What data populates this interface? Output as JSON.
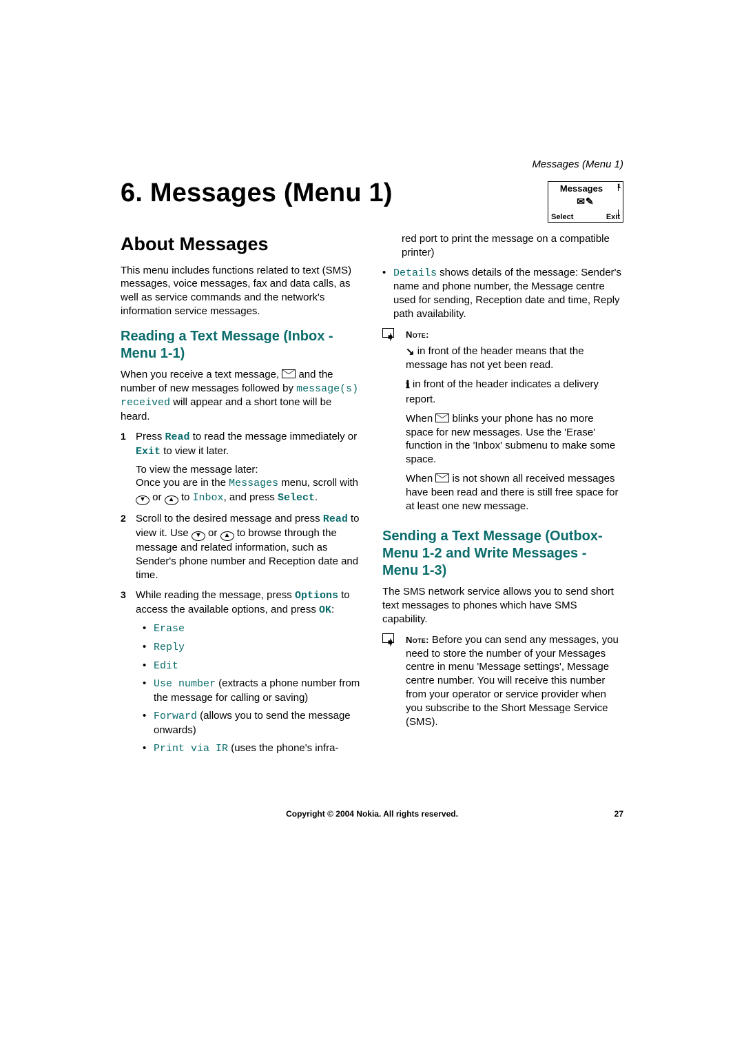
{
  "runningHeader": "Messages (Menu 1)",
  "chapterTitle": "6. Messages (Menu 1)",
  "phoneScreen": {
    "title": "Messages",
    "menuNumber": "1",
    "softLeft": "Select",
    "softRight": "Exit"
  },
  "about": {
    "heading": "About Messages",
    "intro": "This menu includes functions related to text (SMS) messages, voice messages, fax and data calls, as well as service commands and the network's information service messages."
  },
  "reading": {
    "heading": "Reading a Text Message (Inbox - Menu 1-1)",
    "intro_before": "When you receive a text message, ",
    "intro_after_env": " and the number of new messages followed by ",
    "mono_msg": "message(s) received",
    "intro_tail": " will appear and a short tone will be heard.",
    "step1_a": "Press ",
    "step1_read": "Read",
    "step1_b": " to read the message immediately or ",
    "step1_exit": "Exit",
    "step1_c": " to view it later.",
    "step1_p2a": "To view the message later:",
    "step1_p2b_a": "Once you are in the ",
    "step1_p2b_m": "Messages",
    "step1_p2b_b": " menu, scroll with ",
    "step1_p2b_or": " or ",
    "step1_p2b_to": " to ",
    "step1_p2b_inbox": "Inbox",
    "step1_p2b_c": ", and press ",
    "step1_select": "Select",
    "step1_p2b_d": ".",
    "step2_a": "Scroll to the desired message and press ",
    "step2_read": "Read",
    "step2_b": " to view it. Use ",
    "step2_or": " or ",
    "step2_c": " to browse through the message and related information, such as Sender's phone number and Reception date and time.",
    "step3_a": "While reading the message, press ",
    "step3_options": "Options",
    "step3_b": " to access the available options, and press ",
    "step3_ok": "OK",
    "step3_c": ":",
    "opts": {
      "erase": "Erase",
      "reply": "Reply",
      "edit": "Edit",
      "use_number": "Use number",
      "use_number_desc": " (extracts a phone number from the message for calling or saving)",
      "forward": "Forward",
      "forward_desc": "  (allows you to send the message onwards)",
      "print": "Print via IR",
      "print_desc": "  (uses the phone's infra-"
    }
  },
  "rightCol": {
    "cont1": "red port to print the message on a compatible printer)",
    "details_lead": "Details",
    "details_desc": "  shows details of the message: Sender's name and phone number, the Message centre used for sending, Reception date and time, Reply path availability.",
    "noteLabel": "Note:",
    "note1_a": " in front of the header means that the message has not yet been read.",
    "note2_a": " in front of the header indicates a delivery report.",
    "note3_a": "When ",
    "note3_b": " blinks your phone has no more space for new messages. Use the 'Erase' function in the 'Inbox' submenu to make some space.",
    "note4_a": "When ",
    "note4_b": " is not shown all received messages have been read and there is still free space for at least one new message."
  },
  "sending": {
    "heading": "Sending a Text Message (Outbox- Menu 1-2 and Write Messages - Menu 1-3)",
    "intro": "The SMS network service allows you to send short text messages to phones which have SMS capability.",
    "noteLabel": "Note:",
    "noteBody": " Before you can send any messages, you need to store the number of your Messages centre in menu 'Message settings', Message centre number. You will receive this number from your operator or service provider when you subscribe to the Short Message Service (SMS)."
  },
  "footer": {
    "copyright": "Copyright © 2004 Nokia. All rights reserved.",
    "page": "27"
  }
}
